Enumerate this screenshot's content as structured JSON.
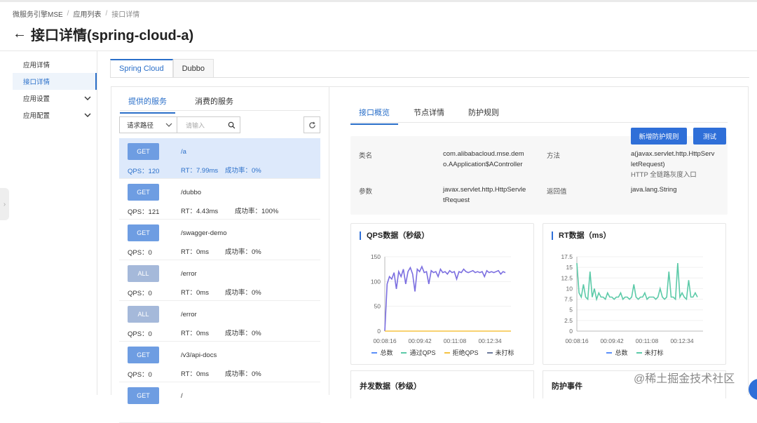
{
  "breadcrumb": [
    "微服务引擎MSE",
    "应用列表",
    "接口详情"
  ],
  "page_title": "接口详情(spring-cloud-a)",
  "sidebar": {
    "items": [
      {
        "label": "应用详情",
        "active": false,
        "expandable": false
      },
      {
        "label": "接口详情",
        "active": true,
        "expandable": false
      },
      {
        "label": "应用设置",
        "active": false,
        "expandable": true
      },
      {
        "label": "应用配置",
        "active": false,
        "expandable": true
      }
    ]
  },
  "top_tabs": [
    {
      "label": "Spring Cloud",
      "active": true
    },
    {
      "label": "Dubbo",
      "active": false
    }
  ],
  "service_tabs": [
    {
      "label": "提供的服务",
      "active": true
    },
    {
      "label": "消费的服务",
      "active": false
    }
  ],
  "search": {
    "select_value": "请求路径",
    "placeholder": "请输入"
  },
  "endpoints": [
    {
      "method": "GET",
      "path": "/a",
      "qps": "QPS：120",
      "rt": "RT：7.99ms",
      "success": "成功率：0%",
      "selected": true
    },
    {
      "method": "GET",
      "path": "/dubbo",
      "qps": "QPS：121",
      "rt": "RT：4.43ms",
      "success": "成功率：100%",
      "selected": false
    },
    {
      "method": "GET",
      "path": "/swagger-demo",
      "qps": "QPS：0",
      "rt": "RT：0ms",
      "success": "成功率：0%",
      "selected": false
    },
    {
      "method": "ALL",
      "path": "/error",
      "qps": "QPS：0",
      "rt": "RT：0ms",
      "success": "成功率：0%",
      "selected": false
    },
    {
      "method": "ALL",
      "path": "/error",
      "qps": "QPS：0",
      "rt": "RT：0ms",
      "success": "成功率：0%",
      "selected": false
    },
    {
      "method": "GET",
      "path": "/v3/api-docs",
      "qps": "QPS：0",
      "rt": "RT：0ms",
      "success": "成功率：0%",
      "selected": false
    },
    {
      "method": "GET",
      "path": "/",
      "qps": "",
      "rt": "",
      "success": "",
      "selected": false
    }
  ],
  "detail_tabs": [
    {
      "label": "接口概览",
      "active": true
    },
    {
      "label": "节点详情",
      "active": false
    },
    {
      "label": "防护规则",
      "active": false
    }
  ],
  "buttons": {
    "add_rule": "新增防护规则",
    "test": "测试"
  },
  "info": {
    "class_label": "类名",
    "class_value_1": "com.alibabacloud.mse.dem",
    "class_value_2": "o.AApplication$AController",
    "method_label": "方法",
    "method_value_1": "a(javax.servlet.http.HttpServ",
    "method_value_2": "letRequest)",
    "method_value_3": "HTTP 全链路灰度入口",
    "param_label": "参数",
    "param_value_1": "javax.servlet.http.HttpServle",
    "param_value_2": "tRequest",
    "return_label": "返回值",
    "return_value": "java.lang.String"
  },
  "colors": {
    "accent": "#2f6fd8",
    "qps_series": "#7b6ee0",
    "rt_series": "#5ccaa8",
    "reject_series": "#f5c342",
    "total_series": "#5b8ff9"
  },
  "chart_data": [
    {
      "type": "line",
      "title": "QPS数据（秒级）",
      "x_ticks": [
        "00:08:16",
        "00:09:42",
        "00:11:08",
        "00:12:34"
      ],
      "y_ticks": [
        0,
        50,
        100,
        150
      ],
      "ylim": [
        0,
        150
      ],
      "series": [
        {
          "name": "总数",
          "values": []
        },
        {
          "name": "通过QPS",
          "values": [
            0,
            95,
            110,
            105,
            118,
            85,
            120,
            110,
            125,
            95,
            120,
            128,
            115,
            80,
            125,
            120,
            130,
            118,
            120,
            95,
            122,
            118,
            120,
            110,
            125,
            118,
            120,
            115,
            122,
            118,
            120,
            105,
            120,
            118,
            125,
            120,
            118,
            120,
            122,
            118,
            120,
            118,
            120,
            110,
            122,
            118,
            120,
            118,
            120,
            122,
            115,
            120,
            118
          ]
        },
        {
          "name": "拒绝QPS",
          "values": [
            0,
            0,
            0,
            0,
            0,
            0,
            0,
            0,
            0,
            0
          ]
        },
        {
          "name": "未打标",
          "values": []
        }
      ],
      "legend_position": "bottom"
    },
    {
      "type": "line",
      "title": "RT数据（ms）",
      "x_ticks": [
        "00:08:16",
        "00:09:42",
        "00:11:08",
        "00:12:34"
      ],
      "y_ticks": [
        0,
        2.5,
        5,
        7.5,
        10,
        12.5,
        15,
        17.5
      ],
      "ylim": [
        0,
        17.5
      ],
      "series": [
        {
          "name": "总数",
          "values": []
        },
        {
          "name": "未打标",
          "values": [
            16,
            9,
            8,
            11,
            8,
            7.5,
            14,
            8,
            10,
            7.5,
            9,
            8,
            8,
            7.5,
            9,
            8,
            8,
            7.5,
            8,
            8,
            9,
            7.5,
            8,
            8,
            7.5,
            8,
            11,
            8,
            7.5,
            8,
            8,
            9,
            7.5,
            8,
            8,
            8,
            7.5,
            8,
            10,
            8,
            7.5,
            8,
            14,
            8,
            8,
            7.5,
            16,
            8,
            9,
            8,
            7.5,
            12,
            8,
            8,
            9,
            8
          ]
        }
      ],
      "legend_position": "bottom"
    }
  ],
  "bottom_cards": [
    "并发数据（秒级）",
    "防护事件"
  ],
  "watermark": "@稀土掘金技术社区"
}
